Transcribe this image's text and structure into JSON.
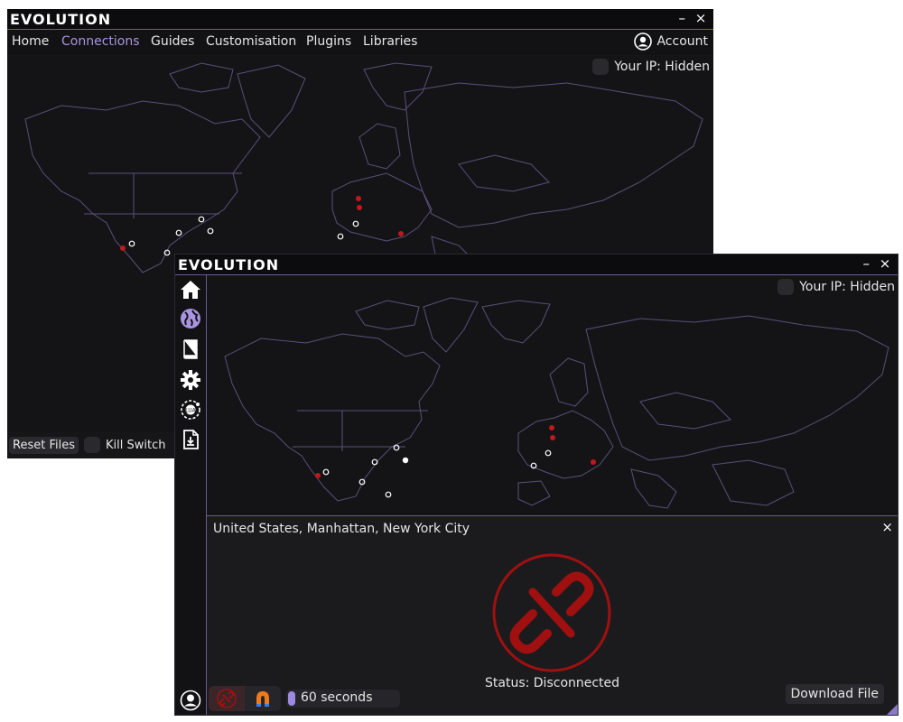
{
  "back_window": {
    "logo": "EVOLUTION",
    "controls": {
      "minimize": "–",
      "close": "×"
    },
    "nav": [
      {
        "label": "Home",
        "active": false
      },
      {
        "label": "Connections",
        "active": true
      },
      {
        "label": "Guides",
        "active": false
      },
      {
        "label": "Customisation",
        "active": false
      },
      {
        "label": "Plugins",
        "active": false
      },
      {
        "label": "Libraries",
        "active": false
      }
    ],
    "account_label": "Account",
    "ip_label": "Your IP: Hidden",
    "reset_label": "Reset Files",
    "kill_switch_label": "Kill Switch"
  },
  "front_window": {
    "logo": "EVOLUTION",
    "controls": {
      "minimize": "–",
      "close": "×"
    },
    "sidebar_icons": [
      "home-icon",
      "globe-icon",
      "book-icon",
      "gear-icon",
      "plugin-icon",
      "file-download-icon"
    ],
    "ip_label": "Your IP: Hidden",
    "location": "United States, Manhattan, New York City",
    "panel_close": "×",
    "status": "Status: Disconnected",
    "download_label": "Download File",
    "duration_label": "60 seconds"
  },
  "colors": {
    "accent": "#a894e0",
    "server_active": "#c0181c",
    "disconnect_red": "#a01010",
    "map_line": "#5a4f7a"
  }
}
